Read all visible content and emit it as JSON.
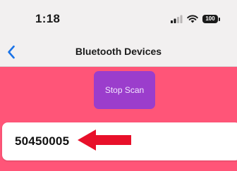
{
  "status_bar": {
    "time": "1:18",
    "battery_level": "100",
    "icons": [
      "signal-icon",
      "wifi-icon",
      "battery-icon"
    ]
  },
  "nav": {
    "back_icon": "chevron-left-icon",
    "title": "Bluetooth Devices",
    "accent_color": "#1a73e8"
  },
  "main": {
    "background_color": "#ff5578",
    "scan_button": {
      "label": "Stop Scan",
      "color": "#9b3dcc"
    },
    "devices": [
      {
        "name": "50450005"
      }
    ],
    "annotation": {
      "icon": "red-arrow-icon",
      "color": "#e8102a"
    }
  }
}
